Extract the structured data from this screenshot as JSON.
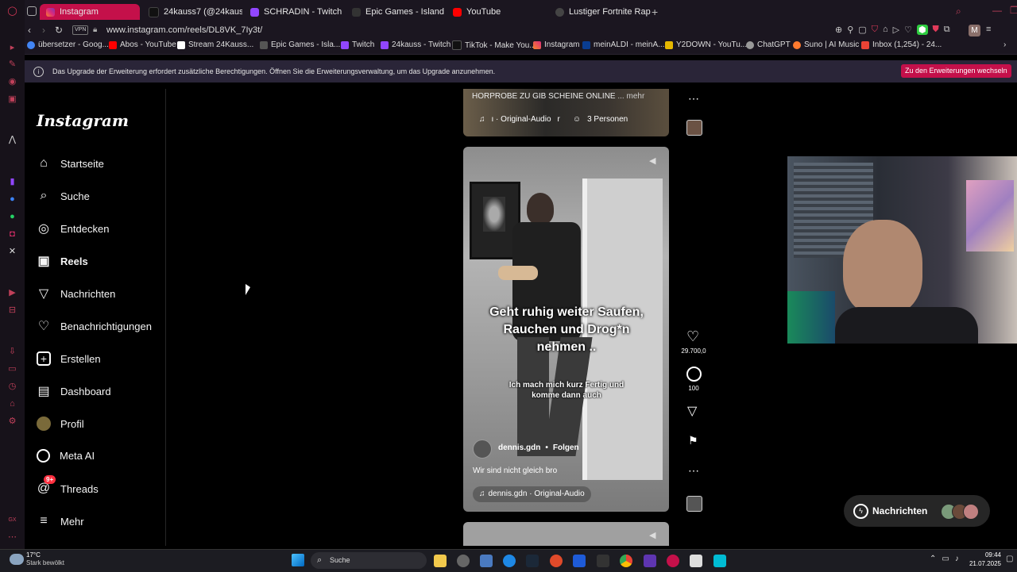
{
  "browser": {
    "tabs": [
      {
        "label": "Instagram",
        "active": true
      },
      {
        "label": "24kauss7 (@24kauss7) |"
      },
      {
        "label": "SCHRADIN - Twitch"
      },
      {
        "label": "Epic Games - Island Crea"
      },
      {
        "label": "YouTube"
      },
      {
        "label": "Lustiger Fortnite Rap"
      }
    ],
    "vpn_label": "VPN",
    "url": "www.instagram.com/reels/DL8VK_7Iy3t/",
    "profile_initial": "M",
    "bookmarks": [
      "übersetzer - Goog...",
      "Abos - YouTube",
      "Stream 24Kauss...",
      "Epic Games - Isla...",
      "Twitch",
      "24kauss - Twitch",
      "TikTok - Make You...",
      "Instagram",
      "meinALDI - meinA...",
      "Y2DOWN - YouTu...",
      "ChatGPT",
      "Suno | AI Music",
      "Inbox (1,254) - 24..."
    ],
    "notification": {
      "text": "Das Upgrade der Erweiterung erfordert zusätzliche Berechtigungen. Öffnen Sie die Erweiterungsverwaltung, um das Upgrade anzunehmen.",
      "button": "Zu den Erweiterungen wechseln"
    }
  },
  "instagram": {
    "logo": "Instagram",
    "nav": [
      {
        "label": "Startseite",
        "icon": "home-icon"
      },
      {
        "label": "Suche",
        "icon": "search-icon"
      },
      {
        "label": "Entdecken",
        "icon": "compass-icon"
      },
      {
        "label": "Reels",
        "icon": "reels-icon",
        "active": true
      },
      {
        "label": "Nachrichten",
        "icon": "send-icon"
      },
      {
        "label": "Benachrichtigungen",
        "icon": "heart-icon"
      },
      {
        "label": "Erstellen",
        "icon": "plus-icon"
      },
      {
        "label": "Dashboard",
        "icon": "dashboard-icon"
      },
      {
        "label": "Profil",
        "icon": "avatar-icon"
      },
      {
        "label": "Meta AI",
        "icon": "meta-ai-icon"
      },
      {
        "label": "Threads",
        "icon": "threads-icon",
        "badge": "9+"
      },
      {
        "label": "Mehr",
        "icon": "menu-icon"
      }
    ],
    "prev_reel": {
      "caption": "HORPROBE ZU GIB SCHEINE ONLINE",
      "more": "... mehr",
      "audio": "ı · Original-Audio",
      "audio_suffix": "r",
      "people": "3 Personen"
    },
    "reel": {
      "overlay_main": "Geht ruhig weiter Saufen, Rauchen und Drog*n nehmen ..",
      "overlay_sub": "Ich mach mich kurz Fertig und komme dann auch",
      "username": "dennis.gdn",
      "dot": "•",
      "follow": "Folgen",
      "caption": "Wir sind nicht gleich bro",
      "audio": "dennis.gdn · Original-Audio",
      "likes": "29.700,0",
      "comments": "100"
    },
    "messages_button": "Nachrichten"
  },
  "taskbar": {
    "weather_temp": "17°C",
    "weather_desc": "Stark bewölkt",
    "search_placeholder": "Suche",
    "time": "09:44",
    "date": "21.07.2025"
  },
  "colors": {
    "accent": "#c4104a",
    "notif_bg": "#2a2538",
    "ig_bg": "#000000"
  }
}
